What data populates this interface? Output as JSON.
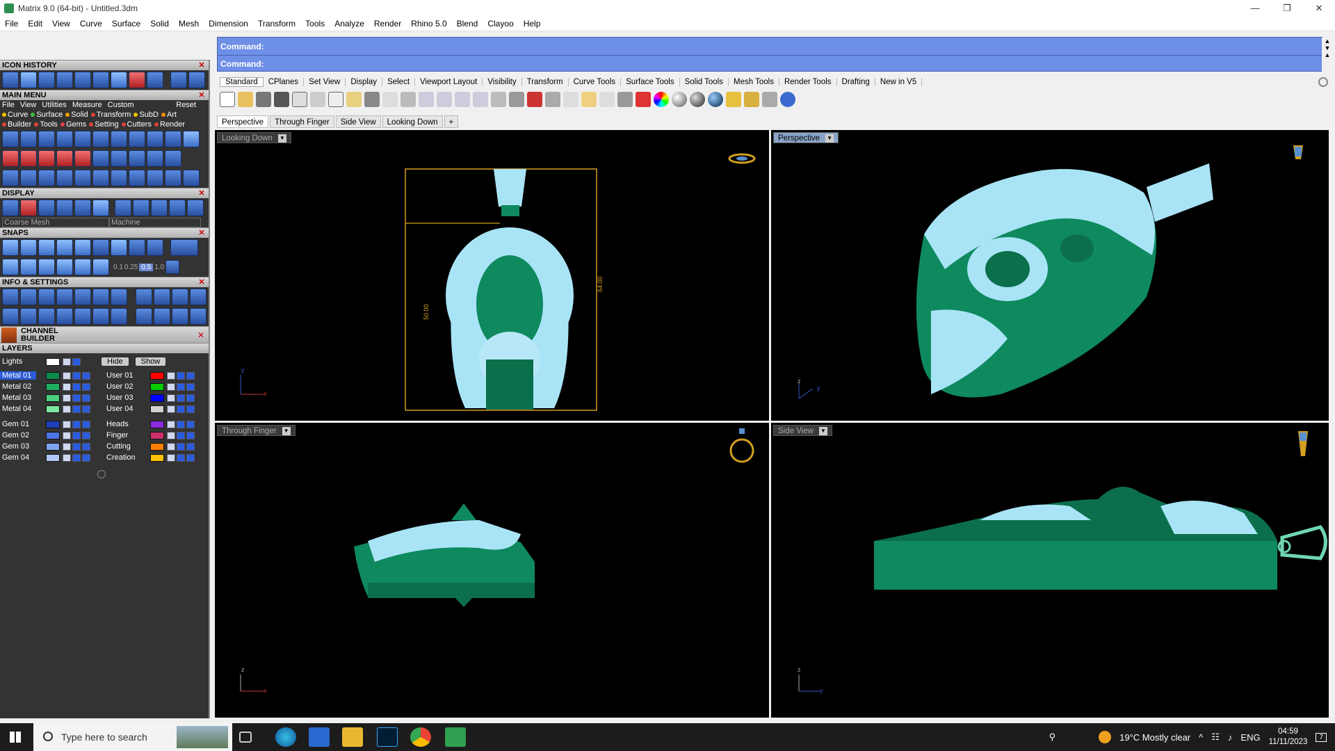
{
  "window": {
    "title": "Matrix 9.0 (64-bit) - Untitled.3dm",
    "controls": [
      "—",
      "❐",
      "✕"
    ]
  },
  "menubar": [
    "File",
    "Edit",
    "View",
    "Curve",
    "Surface",
    "Solid",
    "Mesh",
    "Dimension",
    "Transform",
    "Tools",
    "Analyze",
    "Render",
    "Rhino 5.0",
    "Blend",
    "Clayoo",
    "Help"
  ],
  "left": {
    "icon_history": "ICON HISTORY",
    "main_menu": "MAIN MENU",
    "main_menu_bar": [
      "File",
      "View",
      "Utilities",
      "Measure",
      "Custom",
      "Reset"
    ],
    "main_menu_row1": [
      "Curve",
      "Surface",
      "Solid",
      "Transform",
      "SubD",
      "Art"
    ],
    "main_menu_row2": [
      "Builder",
      "Tools",
      "Gems",
      "Setting",
      "Cutters",
      "Render"
    ],
    "display": "DISPLAY",
    "display_mesh": "Coarse Mesh",
    "display_machine": "Machine",
    "snaps": "SNAPS",
    "snap_values": [
      "0.1",
      "0.25",
      "0.5",
      "1.0"
    ],
    "info_settings": "INFO & SETTINGS",
    "channel_builder": "CHANNEL BUILDER",
    "layers": "LAYERS",
    "lights": "Lights",
    "hide": "Hide",
    "show": "Show",
    "layers_left": [
      {
        "name": "Metal 01",
        "color": "#0c8a4c",
        "selected": true
      },
      {
        "name": "Metal 02",
        "color": "#1faf63"
      },
      {
        "name": "Metal 03",
        "color": "#4bd07e"
      },
      {
        "name": "Metal 04",
        "color": "#7de6a0"
      },
      {
        "name": "Gem 01",
        "color": "#1e3fb8"
      },
      {
        "name": "Gem 02",
        "color": "#4b74e6"
      },
      {
        "name": "Gem 03",
        "color": "#7fa3f0"
      },
      {
        "name": "Gem 04",
        "color": "#b0c8f6"
      }
    ],
    "layers_right": [
      {
        "name": "User 01",
        "color": "#ff0000"
      },
      {
        "name": "User 02",
        "color": "#00cc00"
      },
      {
        "name": "User 03",
        "color": "#0000ff"
      },
      {
        "name": "User 04",
        "color": "#d0d0d0"
      },
      {
        "name": "Heads",
        "color": "#8a2be2"
      },
      {
        "name": "Finger",
        "color": "#d0306a"
      },
      {
        "name": "Cutting",
        "color": "#ff7f00"
      },
      {
        "name": "Creation",
        "color": "#ffc000"
      }
    ]
  },
  "command": {
    "line1": "Command:",
    "line2": "Command:"
  },
  "toolbar_tabs": [
    "Standard",
    "CPlanes",
    "Set View",
    "Display",
    "Select",
    "Viewport Layout",
    "Visibility",
    "Transform",
    "Curve Tools",
    "Surface Tools",
    "Solid Tools",
    "Mesh Tools",
    "Render Tools",
    "Drafting",
    "New in V5"
  ],
  "viewport_tabs": [
    "Perspective",
    "Through Finger",
    "Side View",
    "Looking Down"
  ],
  "viewports": {
    "top_left": {
      "label": "Looking Down",
      "dim_width": "50.00",
      "dim_height": "64.00",
      "axis_x": "x",
      "axis_y": "y"
    },
    "top_right": {
      "label": "Perspective",
      "axis_z": "z",
      "axis_y": "y"
    },
    "bottom_left": {
      "label": "Through Finger",
      "axis_z": "z",
      "axis_x": "x"
    },
    "bottom_right": {
      "label": "Side View",
      "axis_z": "z",
      "axis_y": "y"
    }
  },
  "taskbar": {
    "search_placeholder": "Type here to search",
    "weather": "19°C  Mostly clear",
    "lang": "ENG",
    "time": "04:59",
    "date": "11/11/2023",
    "notifications": "7"
  }
}
